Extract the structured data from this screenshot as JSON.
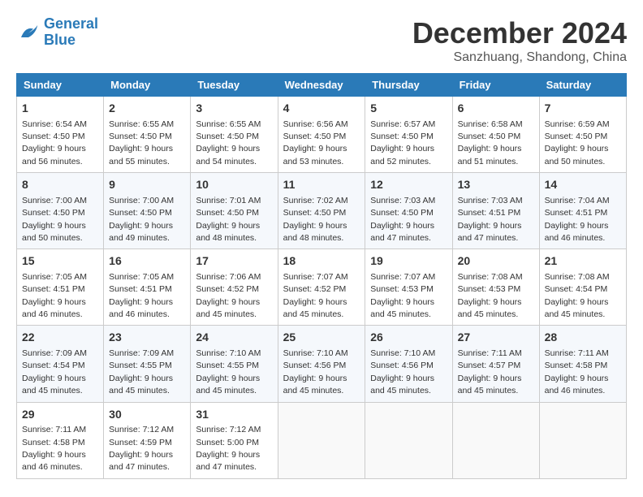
{
  "header": {
    "logo_general": "General",
    "logo_blue": "Blue",
    "month_title": "December 2024",
    "subtitle": "Sanzhuang, Shandong, China"
  },
  "weekdays": [
    "Sunday",
    "Monday",
    "Tuesday",
    "Wednesday",
    "Thursday",
    "Friday",
    "Saturday"
  ],
  "weeks": [
    [
      {
        "day": "1",
        "sunrise": "6:54 AM",
        "sunset": "4:50 PM",
        "daylight": "9 hours and 56 minutes."
      },
      {
        "day": "2",
        "sunrise": "6:55 AM",
        "sunset": "4:50 PM",
        "daylight": "9 hours and 55 minutes."
      },
      {
        "day": "3",
        "sunrise": "6:55 AM",
        "sunset": "4:50 PM",
        "daylight": "9 hours and 54 minutes."
      },
      {
        "day": "4",
        "sunrise": "6:56 AM",
        "sunset": "4:50 PM",
        "daylight": "9 hours and 53 minutes."
      },
      {
        "day": "5",
        "sunrise": "6:57 AM",
        "sunset": "4:50 PM",
        "daylight": "9 hours and 52 minutes."
      },
      {
        "day": "6",
        "sunrise": "6:58 AM",
        "sunset": "4:50 PM",
        "daylight": "9 hours and 51 minutes."
      },
      {
        "day": "7",
        "sunrise": "6:59 AM",
        "sunset": "4:50 PM",
        "daylight": "9 hours and 50 minutes."
      }
    ],
    [
      {
        "day": "8",
        "sunrise": "7:00 AM",
        "sunset": "4:50 PM",
        "daylight": "9 hours and 50 minutes."
      },
      {
        "day": "9",
        "sunrise": "7:00 AM",
        "sunset": "4:50 PM",
        "daylight": "9 hours and 49 minutes."
      },
      {
        "day": "10",
        "sunrise": "7:01 AM",
        "sunset": "4:50 PM",
        "daylight": "9 hours and 48 minutes."
      },
      {
        "day": "11",
        "sunrise": "7:02 AM",
        "sunset": "4:50 PM",
        "daylight": "9 hours and 48 minutes."
      },
      {
        "day": "12",
        "sunrise": "7:03 AM",
        "sunset": "4:50 PM",
        "daylight": "9 hours and 47 minutes."
      },
      {
        "day": "13",
        "sunrise": "7:03 AM",
        "sunset": "4:51 PM",
        "daylight": "9 hours and 47 minutes."
      },
      {
        "day": "14",
        "sunrise": "7:04 AM",
        "sunset": "4:51 PM",
        "daylight": "9 hours and 46 minutes."
      }
    ],
    [
      {
        "day": "15",
        "sunrise": "7:05 AM",
        "sunset": "4:51 PM",
        "daylight": "9 hours and 46 minutes."
      },
      {
        "day": "16",
        "sunrise": "7:05 AM",
        "sunset": "4:51 PM",
        "daylight": "9 hours and 46 minutes."
      },
      {
        "day": "17",
        "sunrise": "7:06 AM",
        "sunset": "4:52 PM",
        "daylight": "9 hours and 45 minutes."
      },
      {
        "day": "18",
        "sunrise": "7:07 AM",
        "sunset": "4:52 PM",
        "daylight": "9 hours and 45 minutes."
      },
      {
        "day": "19",
        "sunrise": "7:07 AM",
        "sunset": "4:53 PM",
        "daylight": "9 hours and 45 minutes."
      },
      {
        "day": "20",
        "sunrise": "7:08 AM",
        "sunset": "4:53 PM",
        "daylight": "9 hours and 45 minutes."
      },
      {
        "day": "21",
        "sunrise": "7:08 AM",
        "sunset": "4:54 PM",
        "daylight": "9 hours and 45 minutes."
      }
    ],
    [
      {
        "day": "22",
        "sunrise": "7:09 AM",
        "sunset": "4:54 PM",
        "daylight": "9 hours and 45 minutes."
      },
      {
        "day": "23",
        "sunrise": "7:09 AM",
        "sunset": "4:55 PM",
        "daylight": "9 hours and 45 minutes."
      },
      {
        "day": "24",
        "sunrise": "7:10 AM",
        "sunset": "4:55 PM",
        "daylight": "9 hours and 45 minutes."
      },
      {
        "day": "25",
        "sunrise": "7:10 AM",
        "sunset": "4:56 PM",
        "daylight": "9 hours and 45 minutes."
      },
      {
        "day": "26",
        "sunrise": "7:10 AM",
        "sunset": "4:56 PM",
        "daylight": "9 hours and 45 minutes."
      },
      {
        "day": "27",
        "sunrise": "7:11 AM",
        "sunset": "4:57 PM",
        "daylight": "9 hours and 45 minutes."
      },
      {
        "day": "28",
        "sunrise": "7:11 AM",
        "sunset": "4:58 PM",
        "daylight": "9 hours and 46 minutes."
      }
    ],
    [
      {
        "day": "29",
        "sunrise": "7:11 AM",
        "sunset": "4:58 PM",
        "daylight": "9 hours and 46 minutes."
      },
      {
        "day": "30",
        "sunrise": "7:12 AM",
        "sunset": "4:59 PM",
        "daylight": "9 hours and 47 minutes."
      },
      {
        "day": "31",
        "sunrise": "7:12 AM",
        "sunset": "5:00 PM",
        "daylight": "9 hours and 47 minutes."
      },
      null,
      null,
      null,
      null
    ]
  ]
}
